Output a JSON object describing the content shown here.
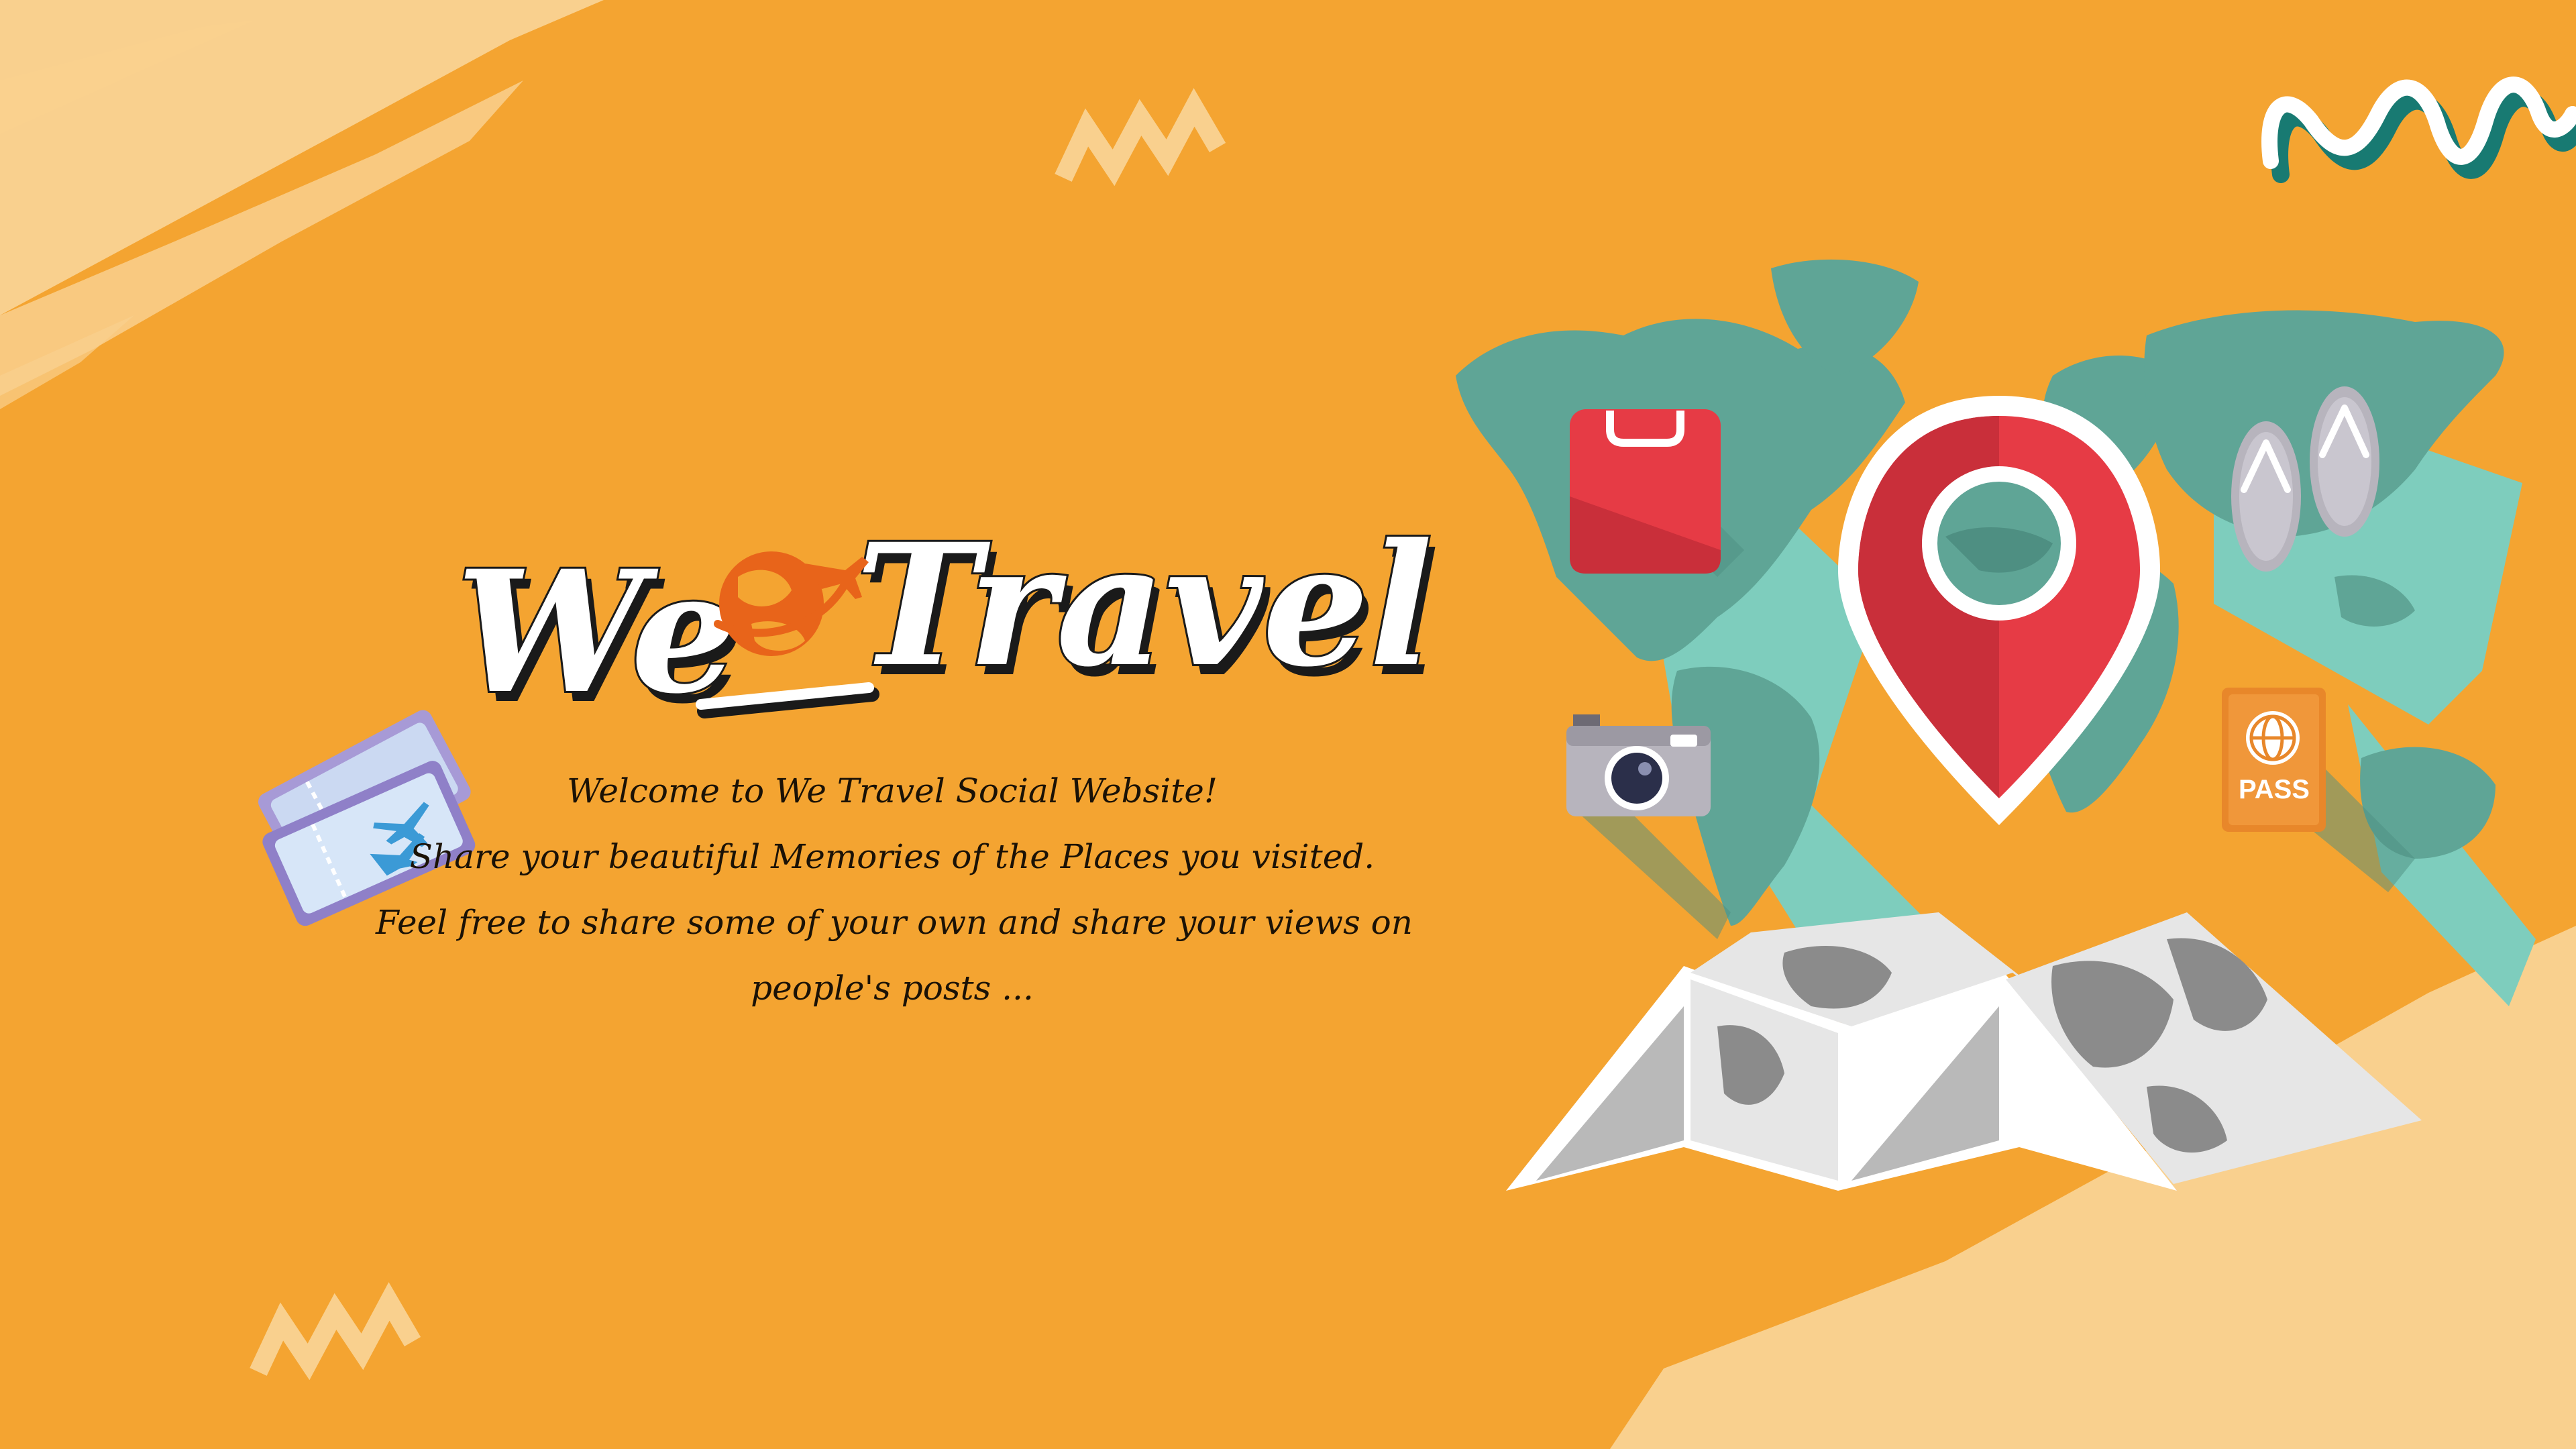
{
  "logo": {
    "word_left": "We",
    "word_right": "Travel"
  },
  "tagline": {
    "line1": "Welcome to We Travel Social Website!",
    "line2": "Share your beautiful Memories of the Places you visited.",
    "line3": "Feel free to share some of your own and share your views on",
    "line4": "people's posts ..."
  },
  "passport": {
    "label": "PASS"
  },
  "icons": [
    "world-map-icon",
    "map-pin-icon",
    "luggage-icon",
    "flip-flops-icon",
    "camera-icon",
    "passport-icon",
    "folded-map-icon",
    "plane-tickets-icon",
    "globe-plane-icon"
  ],
  "colors": {
    "background": "#f4a431",
    "brush": "#f9d08e",
    "map": "#5fa596",
    "pin_red": "#e63b45",
    "logo_orange": "#e8641a",
    "text": "#1b1206"
  }
}
